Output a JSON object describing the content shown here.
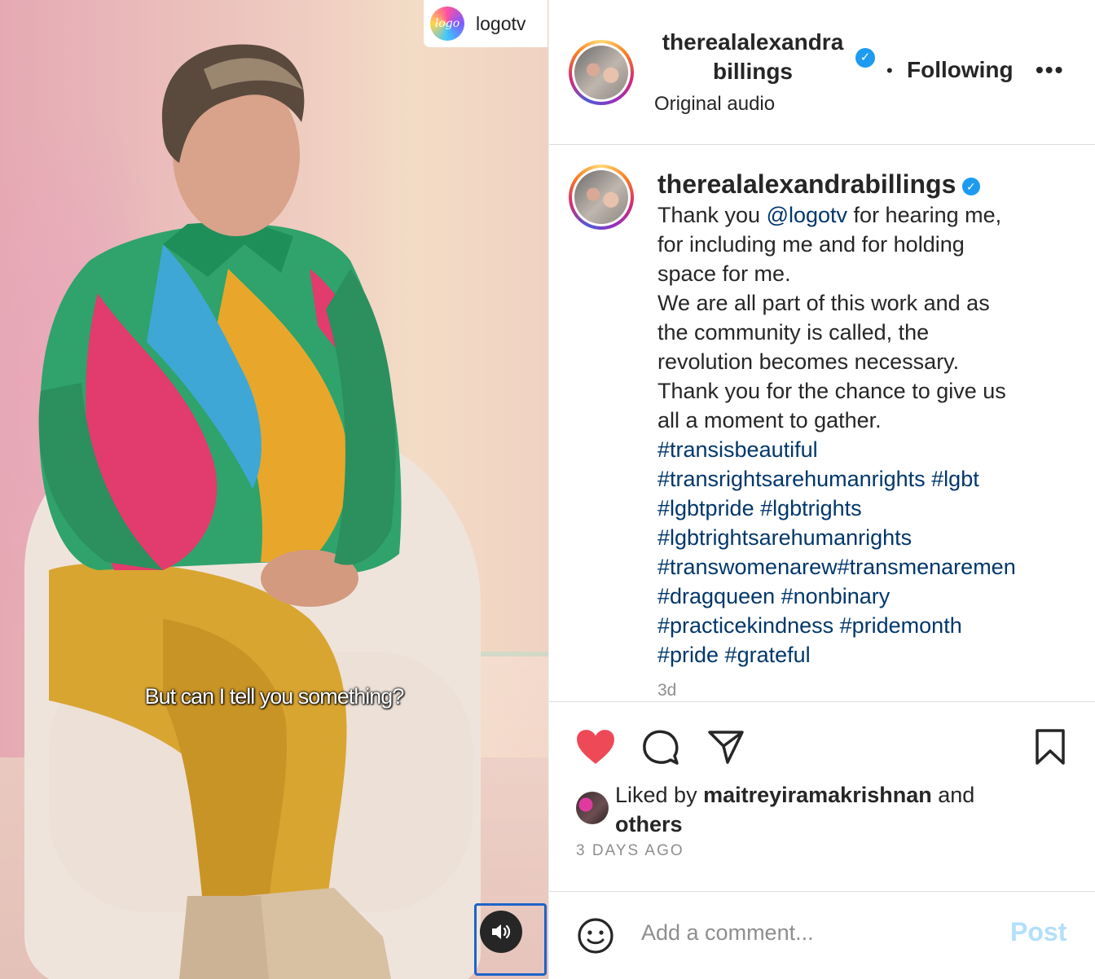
{
  "video": {
    "badge_logo_text": "logo",
    "badge_name": "logotv",
    "subtitle": "But can I tell you something?",
    "audio_icon": "speaker-icon"
  },
  "header": {
    "username_line1": "therealalexandra",
    "username_line2": "billings",
    "verified_icon": "✓",
    "dot": "•",
    "follow_label": "Following",
    "more_icon": "•••",
    "audio_label": "Original audio"
  },
  "caption": {
    "username": "therealalexandrabillings",
    "verified_icon": "✓",
    "line1_pre": "Thank you ",
    "mention": "@logotv",
    "line1_post": " for hearing me,",
    "lines": [
      "for including me and for holding",
      "space for me.",
      "We are all part of this work and as",
      "the community is called, the",
      "revolution becomes necessary.",
      "Thank you for the chance to give us",
      "all a moment to gather."
    ],
    "hashtag_lines": [
      "#transisbeautiful",
      "#transrightsarehumanrights #lgbt",
      "#lgbtpride #lgbtrights",
      "#lgbtrightsarehumanrights",
      "#transwomenarew#transmenaremen",
      "#dragqueen #nonbinary",
      "#practicekindness #pridemonth",
      "#pride #grateful"
    ],
    "time": "3d"
  },
  "actions": {
    "like_icon": "heart-icon",
    "comment_icon": "comment-icon",
    "share_icon": "send-icon",
    "save_icon": "bookmark-icon",
    "liked_prefix": "Liked by ",
    "liked_user": "maitreyiramakrishnan",
    "liked_mid": " and",
    "liked_others": "others",
    "date": "3 DAYS AGO"
  },
  "comment": {
    "emoji_icon": "emoji-icon",
    "placeholder": "Add a comment...",
    "post_label": "Post"
  },
  "colors": {
    "heart": "#ed4956",
    "link": "#00376b",
    "verified": "#1d9bf0",
    "post_disabled": "#b2dffc",
    "secondary_text": "#8e8e8e"
  }
}
